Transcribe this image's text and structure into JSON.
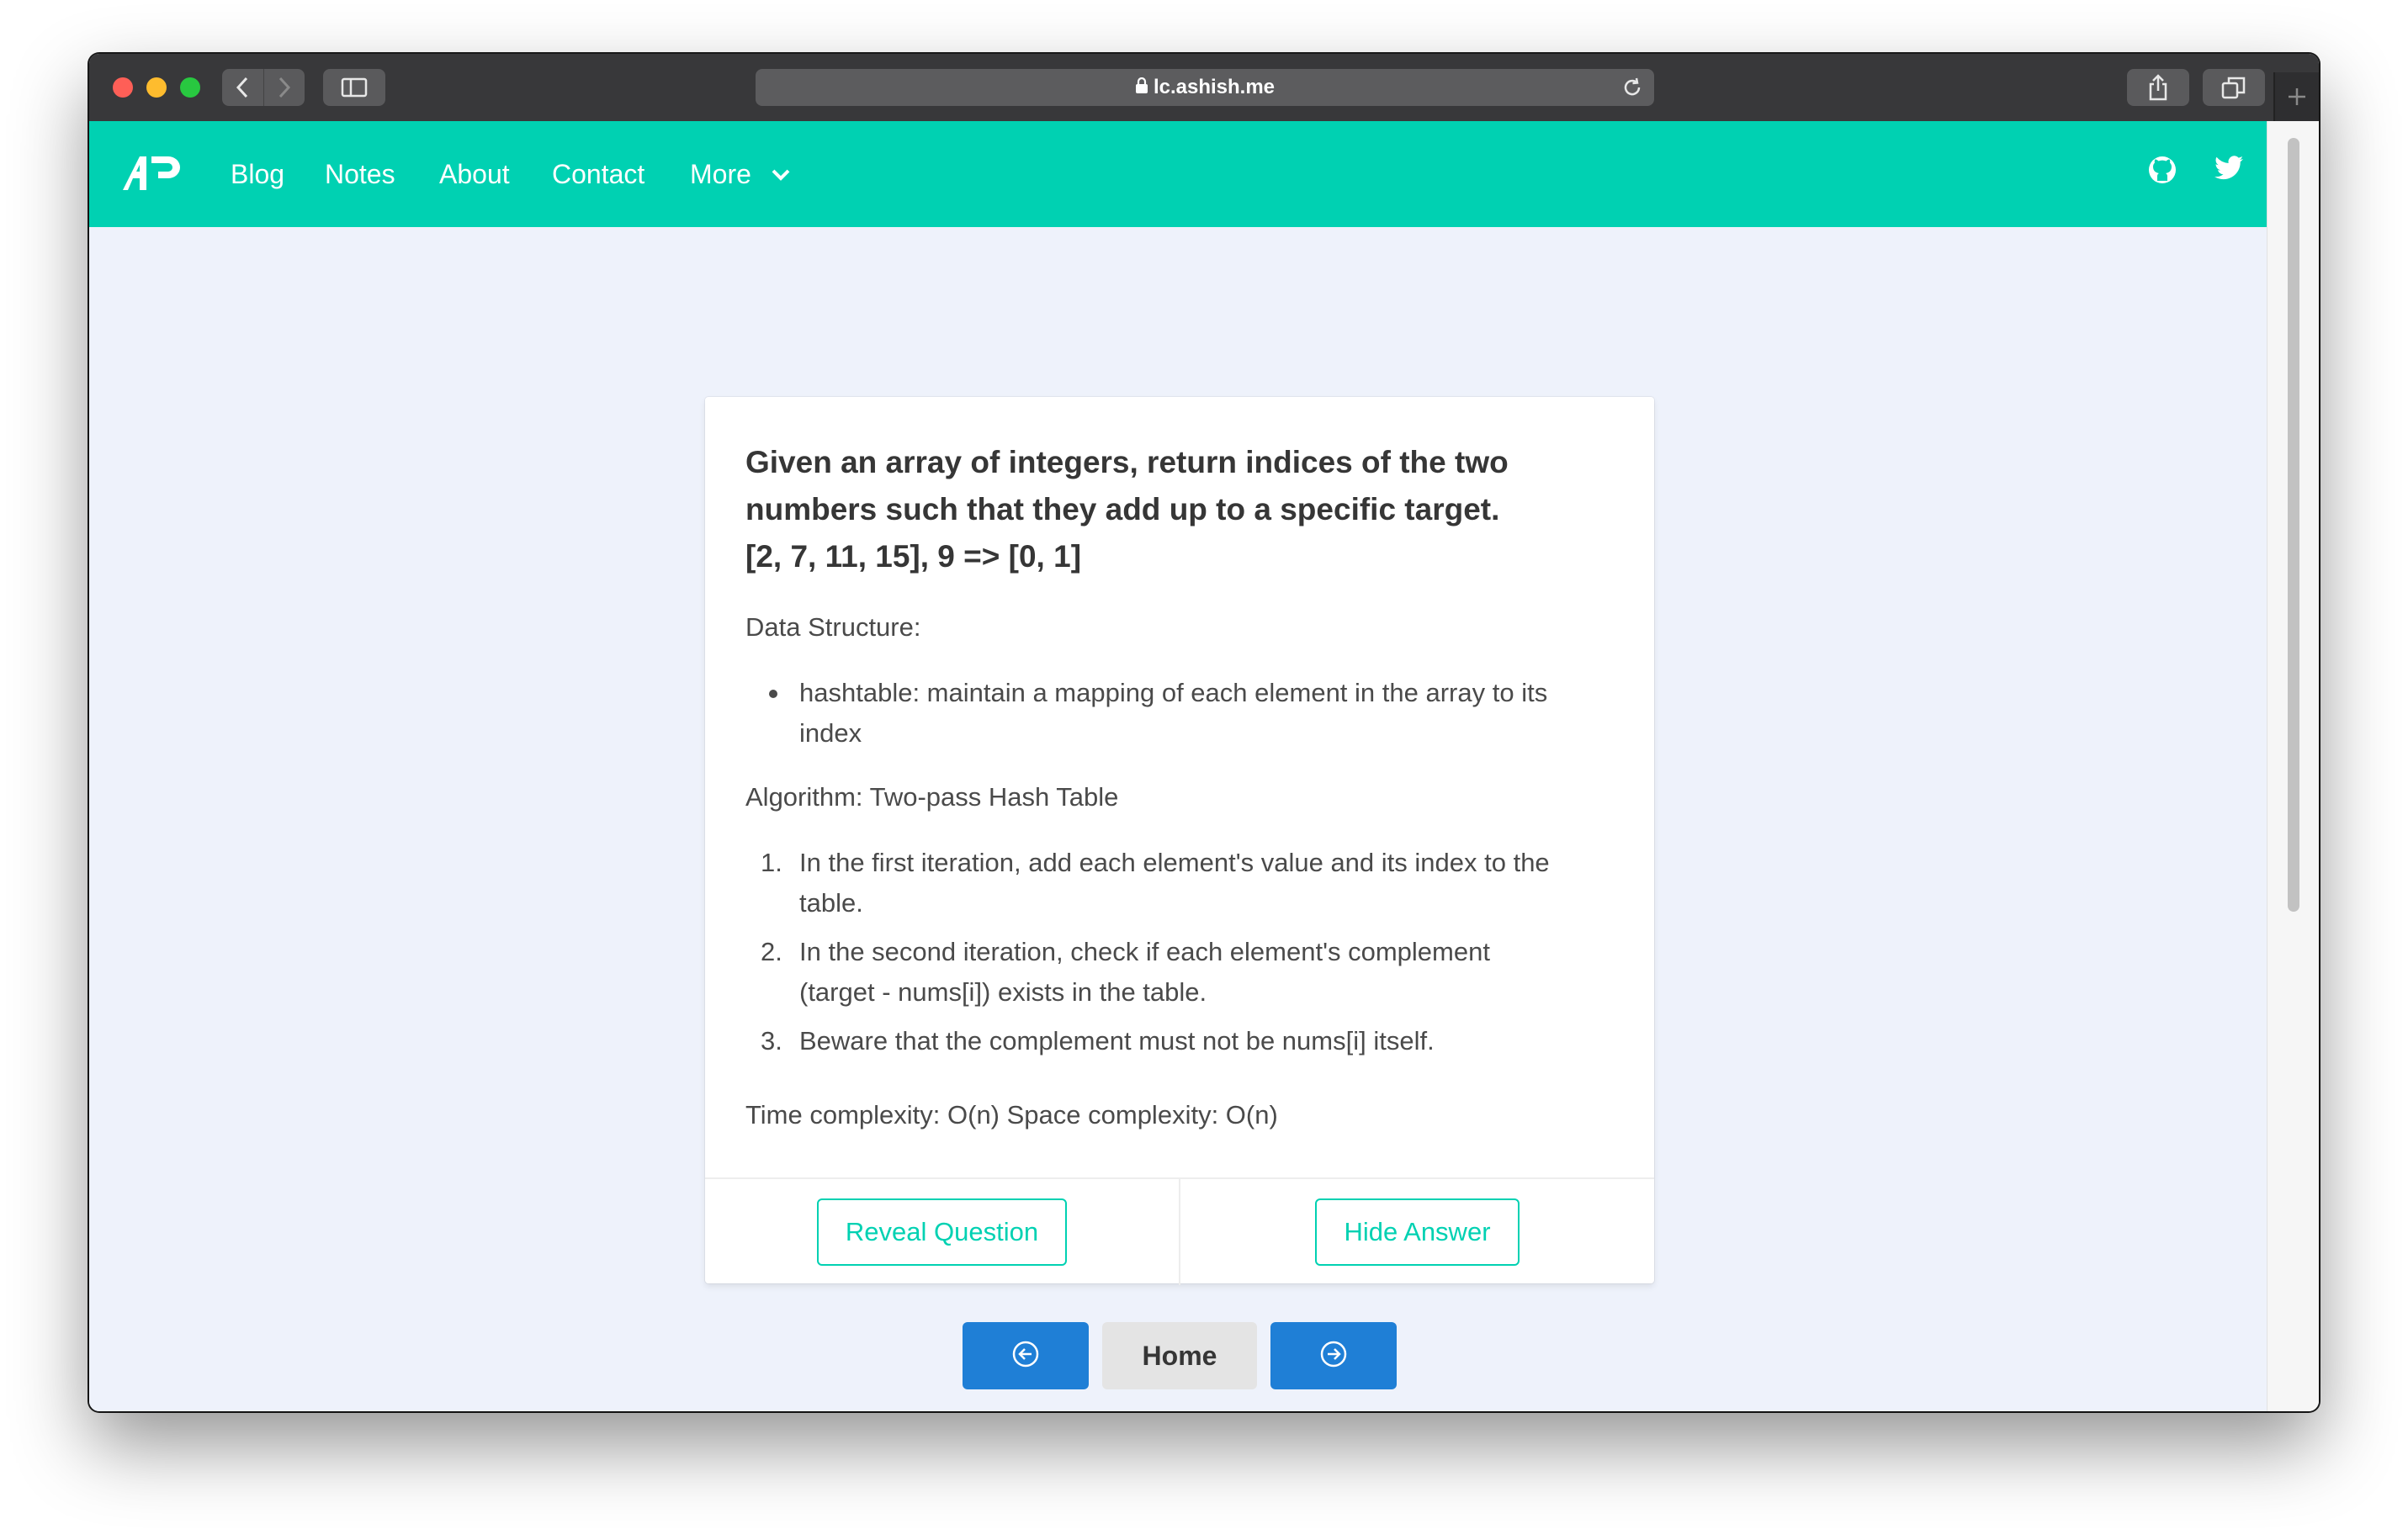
{
  "browser": {
    "url": "lc.ashish.me",
    "icons": [
      "back-icon",
      "forward-icon",
      "sidebar-icon",
      "lock-icon",
      "reload-icon",
      "share-icon",
      "tabs-icon",
      "new-tab-icon"
    ]
  },
  "navbar": {
    "logo_icon": "ap-logo",
    "links": [
      "Blog",
      "Notes",
      "About",
      "Contact"
    ],
    "more_label": "More",
    "social_icons": [
      "github-icon",
      "twitter-icon"
    ],
    "color": "#00d1b2"
  },
  "card": {
    "question_lines": [
      "Given an array of integers, return indices of the two",
      "numbers such that they add up to a specific target.",
      "[2, 7, 11, 15], 9 => [0, 1]"
    ],
    "data_structure_label": "Data Structure:",
    "data_structure_items": [
      {
        "line1": "hashtable: maintain a mapping of each element in the array to its",
        "line2": "index"
      }
    ],
    "algorithm_label": "Algorithm: Two-pass Hash Table",
    "algorithm_steps": [
      {
        "num": "1.",
        "line1": "In the first iteration, add each element's value and its index to the",
        "line2": "table."
      },
      {
        "num": "2.",
        "line1": "In the second iteration, check if each element's complement",
        "line2": "(target - nums[i]) exists in the table."
      },
      {
        "num": "3.",
        "line1": "Beware that the complement must not be nums[i] itself.",
        "line2": ""
      }
    ],
    "complexity": "Time complexity: O(n) Space complexity: O(n)",
    "reveal_question_label": "Reveal Question",
    "hide_answer_label": "Hide Answer"
  },
  "pager": {
    "prev_icon": "arrow-circle-left-icon",
    "home_label": "Home",
    "next_icon": "arrow-circle-right-icon"
  }
}
